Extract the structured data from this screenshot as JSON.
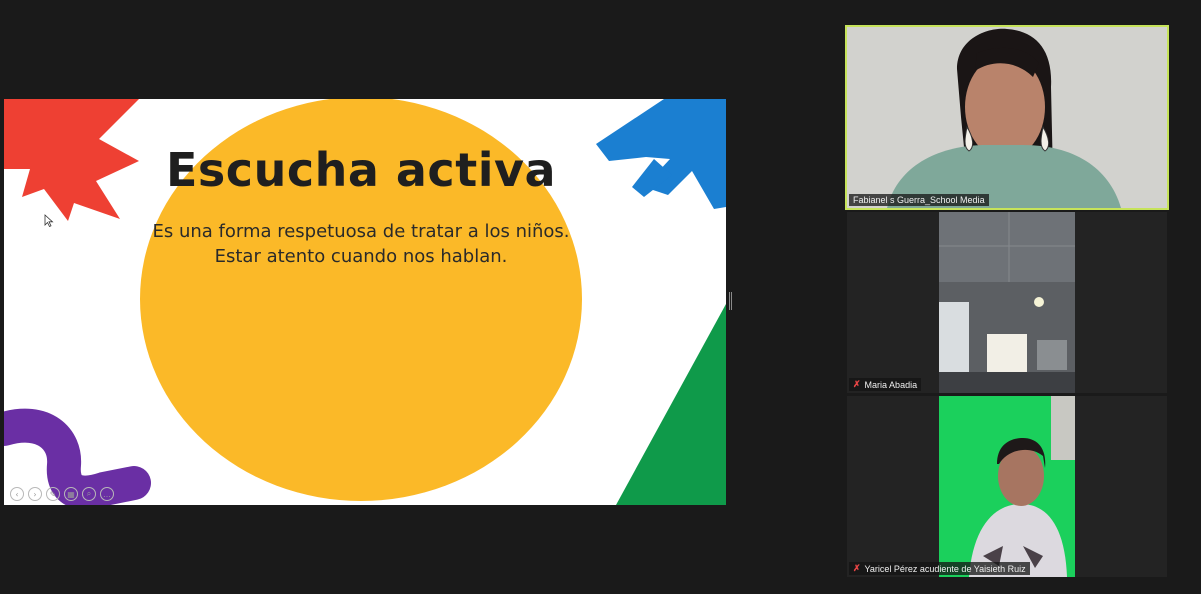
{
  "slide": {
    "title": "Escucha activa",
    "line1": "Es una forma respetuosa de tratar a los niños.",
    "line2": "Estar atento cuando nos hablan.",
    "colors": {
      "yellow": "#fbb928",
      "red": "#ee4033",
      "blue": "#1b7fd1",
      "green": "#0f9a4a",
      "purple": "#6a2fa4"
    }
  },
  "presenter_tools": [
    {
      "icon": "previous-icon",
      "glyph": "‹"
    },
    {
      "icon": "next-icon",
      "glyph": "›"
    },
    {
      "icon": "pen-icon",
      "glyph": "✎"
    },
    {
      "icon": "slides-grid-icon",
      "glyph": "▦"
    },
    {
      "icon": "zoom-icon",
      "glyph": "⌕"
    },
    {
      "icon": "more-icon",
      "glyph": "…"
    }
  ],
  "participants": [
    {
      "name": "Fabianel s Guerra_School Media",
      "muted": false,
      "active": true
    },
    {
      "name": "Maria Abadia",
      "muted": true,
      "active": false
    },
    {
      "name": "Yaricel Pérez acudiente de Yaisieth Ruiz",
      "muted": true,
      "active": false
    }
  ],
  "icons": {
    "mute": "✗"
  }
}
